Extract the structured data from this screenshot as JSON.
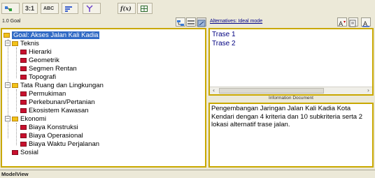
{
  "toolbar": {
    "groups": [
      {
        "icon": "distributive-mode-icon",
        "label": ""
      },
      {
        "icon": "ratio-3-1-icon",
        "label": "3:1"
      },
      {
        "icon": "abc-icon",
        "label": "ABC"
      },
      {
        "icon": "bar-graph-icon",
        "label": ""
      },
      {
        "icon": "split-icon",
        "label": ""
      },
      {
        "icon": "formula-icon",
        "label": "f(x)"
      },
      {
        "icon": "grid-icon",
        "label": ""
      }
    ]
  },
  "left_header": {
    "caption": "1.0 Goal"
  },
  "tree": {
    "goal": {
      "label": "Goal: Akses Jalan Kali Kadia"
    },
    "criteria": [
      {
        "label": "Teknis",
        "children": [
          "Hierarki",
          "Geometrik",
          "Segmen Rentan",
          "Topografi"
        ]
      },
      {
        "label": "Tata Ruang dan Lingkungan",
        "children": [
          "Permukiman",
          "Perkebunan/Pertanian",
          "Ekosistem Kawasan"
        ]
      },
      {
        "label": "Ekonomi",
        "children": [
          "Biaya Konstruksi",
          "Biaya Operasional",
          "Biaya Waktu Perjalanan"
        ]
      },
      {
        "label": "Sosial",
        "children": []
      }
    ]
  },
  "right_header": {
    "caption": "Alternatives: Ideal mode"
  },
  "alternatives": [
    "Trase 1",
    "Trase 2"
  ],
  "information_document": {
    "label": "Information Document",
    "text": "Pengembangan Jaringan Jalan Kali Kadia Kota Kendari dengan 4 kriteria dan 10 subkriteria serta 2 lokasi alternatif trase jalan."
  },
  "status": {
    "view_label": "ModelView"
  },
  "colors": {
    "panel_border": "#c9a800",
    "selection": "#316ac5",
    "criterion_marker": "#f2c21a",
    "subcriterion_marker": "#c8102e",
    "alternative_text": "#000080"
  }
}
